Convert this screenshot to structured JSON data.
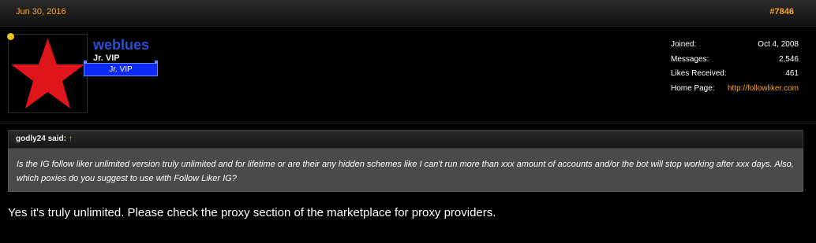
{
  "post": {
    "date": "Jun 30, 2016",
    "number": "#7846"
  },
  "user": {
    "name": "weblues",
    "title": "Jr. VIP",
    "rank_badge": "Jr. VIP",
    "status_color": "#f0c419",
    "avatar_icon": "red-star-icon",
    "avatar_color": "#e0151b",
    "name_color": "#2d4fd6"
  },
  "stats": [
    {
      "label": "Joined:",
      "value": "Oct 4, 2008"
    },
    {
      "label": "Messages:",
      "value": "2,546"
    },
    {
      "label": "Likes Received:",
      "value": "461"
    },
    {
      "label": "Home Page:",
      "value": "http://followliker.com"
    }
  ],
  "quote": {
    "author": "godly24 said:",
    "jump_icon": "↑",
    "text": "Is the IG follow liker unlimited version truly unlimited and for lifetime or are their any hidden schemes like I can't run more than xxx amount of accounts and/or the bot will stop working after xxx days. Also, which poxies do you suggest to use with Follow Liker IG?"
  },
  "message": "Yes it's truly unlimited. Please check the proxy section of the marketplace for proxy providers.",
  "colors": {
    "accent": "#f5a623",
    "badge": "#0d2bf5",
    "quote_bg": "#4a4a4a"
  }
}
